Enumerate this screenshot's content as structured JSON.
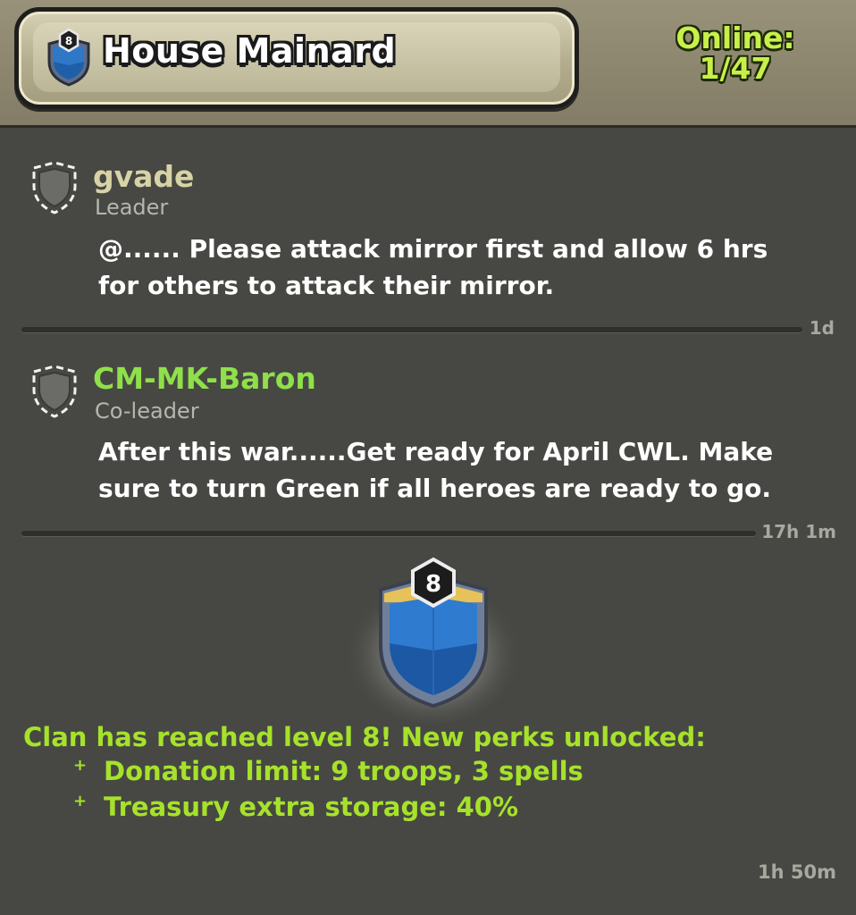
{
  "header": {
    "clan_name": "House Mainard",
    "clan_level": "8",
    "online_label": "Online:",
    "online_count": "1/47"
  },
  "messages": [
    {
      "author": "gvade",
      "role": "Leader",
      "text_line1": "@...... Please attack mirror first and allow 6 hrs",
      "text_line2": "for others to attack their mirror.",
      "time": "1d",
      "author_color": "#d8d3a6"
    },
    {
      "author": "CM-MK-Baron",
      "role": "Co-leader",
      "text_line1": "After this war......Get ready for April CWL. Make",
      "text_line2": "sure to turn Green if all heroes are ready to go.",
      "time": "17h 1m",
      "author_color": "#8fe04a"
    }
  ],
  "level_up": {
    "badge_level": "8",
    "title": "Clan has reached level 8! New perks unlocked:",
    "perks": [
      "Donation limit: 9 troops, 3 spells",
      "Treasury extra storage: 40%"
    ],
    "bullet": "+",
    "time": "1h 50m"
  },
  "colors": {
    "background": "#474843",
    "perk_text": "#a6e22b",
    "online_text": "#c7f04a"
  },
  "icons": [
    "clan-badge-icon",
    "default-shield-icon"
  ]
}
